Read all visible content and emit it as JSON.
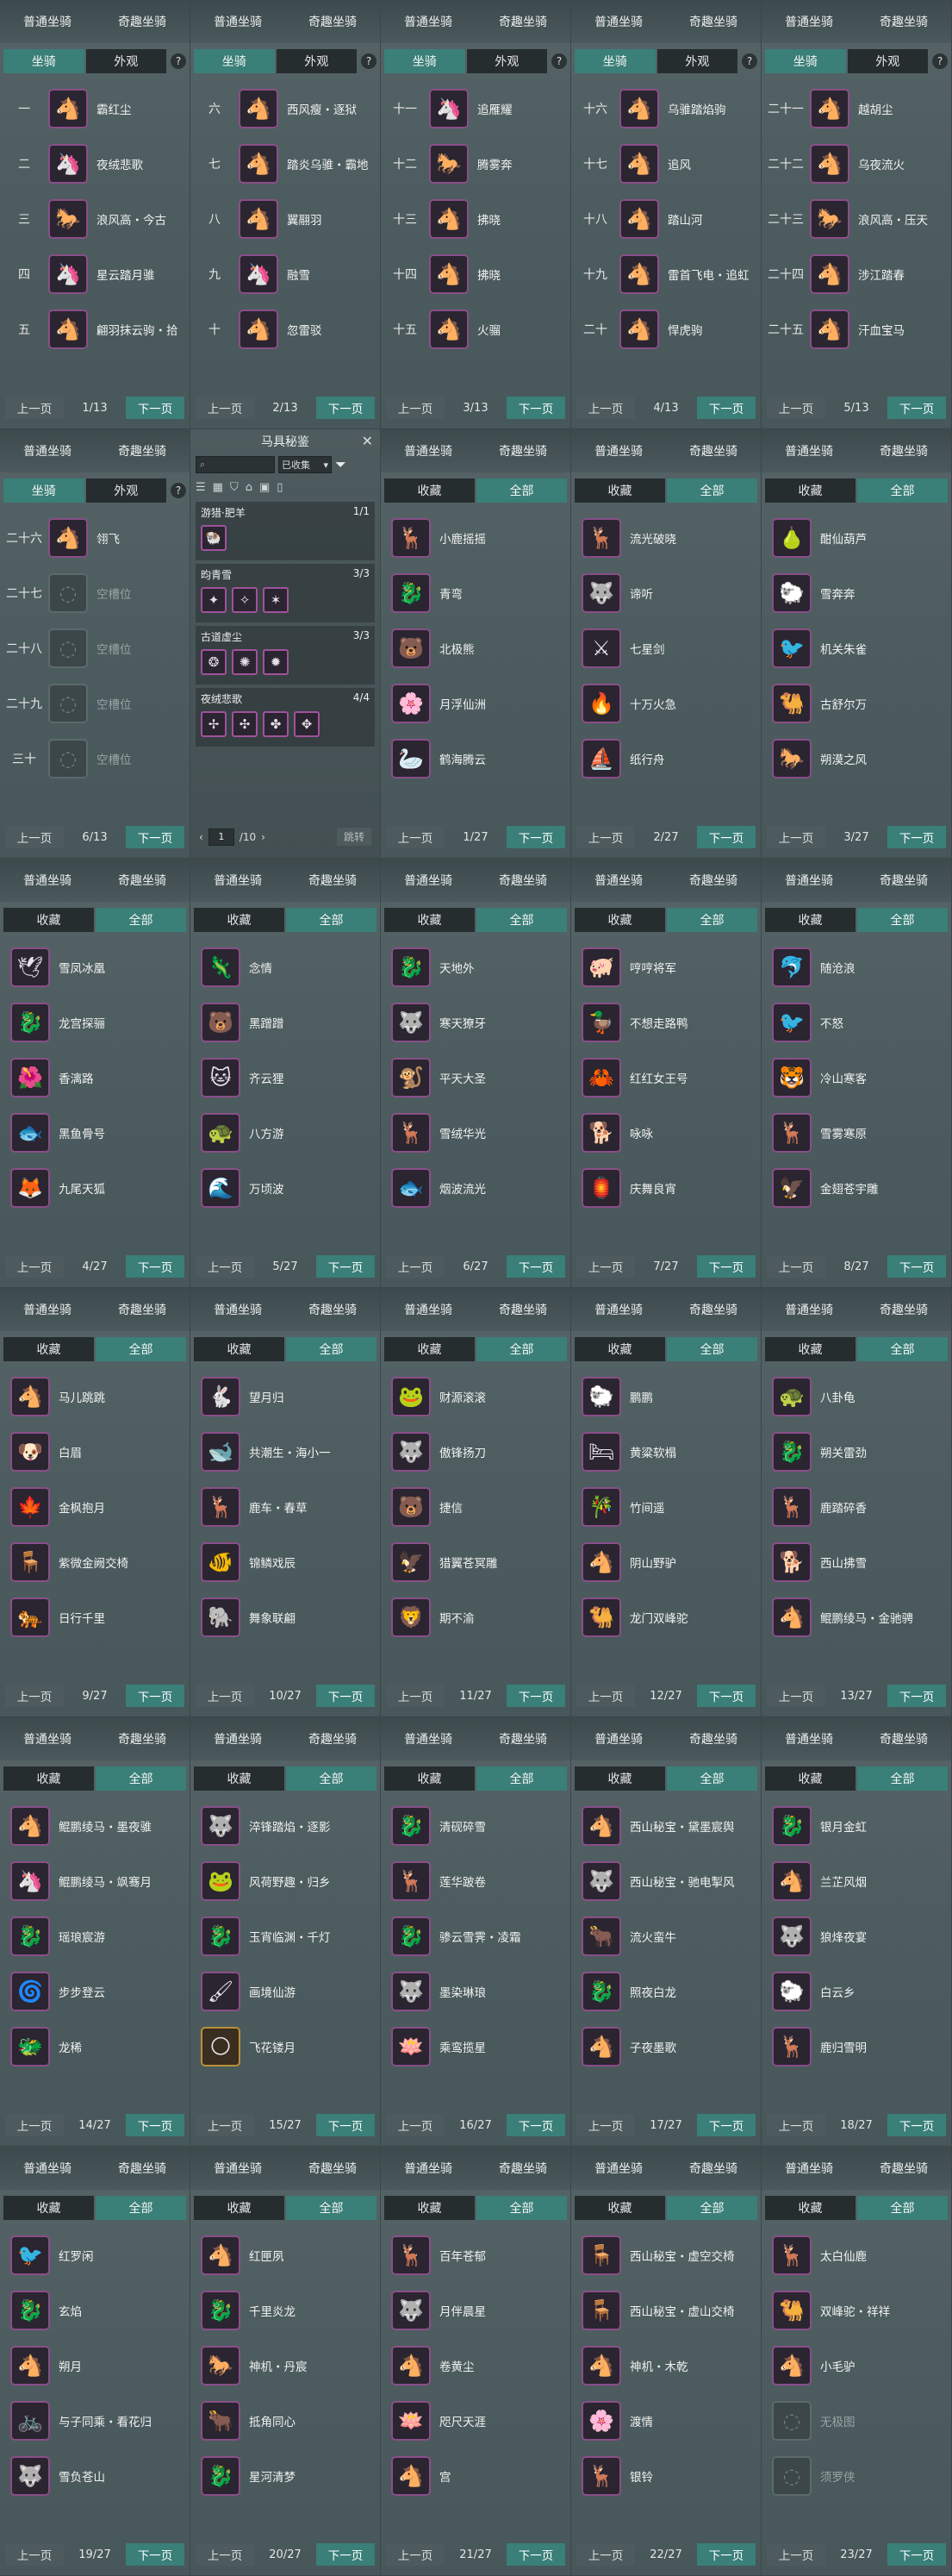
{
  "top_tabs": {
    "common": "普通坐骑",
    "fun": "奇趣坐骑"
  },
  "sub_tabs_mount": {
    "mount": "坐骑",
    "appearance": "外观",
    "help": "?"
  },
  "sub_tabs_item": {
    "favorite": "收藏",
    "all": "全部"
  },
  "pager": {
    "prev": "上一页",
    "next": "下一页"
  },
  "popup": {
    "title": "马具秘鉴",
    "close": "✕",
    "search_placeholder": "",
    "filter": "已收集",
    "sets": [
      {
        "name": "游猎·肥羊",
        "count": "1/1",
        "icons": [
          "🐏"
        ]
      },
      {
        "name": "昀青雪",
        "count": "3/3",
        "icons": [
          "✦",
          "✧",
          "✶"
        ]
      },
      {
        "name": "古道虚尘",
        "count": "3/3",
        "icons": [
          "❂",
          "✺",
          "✹"
        ]
      },
      {
        "name": "夜绒悲歌",
        "count": "4/4",
        "icons": [
          "✢",
          "✣",
          "✤",
          "✥"
        ]
      }
    ],
    "page_input": "1",
    "page_total": "/10",
    "jump": "跳转"
  },
  "panels": [
    {
      "kind": "mount",
      "page": "1/13",
      "rows": [
        {
          "num": "一",
          "name": "霸红尘",
          "icon": "🐴",
          "style": ""
        },
        {
          "num": "二",
          "name": "夜绒悲歌",
          "icon": "🦄",
          "style": ""
        },
        {
          "num": "三",
          "name": "浪风高・今古",
          "icon": "🐎",
          "style": ""
        },
        {
          "num": "四",
          "name": "星云踏月骓",
          "icon": "🦄",
          "style": ""
        },
        {
          "num": "五",
          "name": "翩羽抹云驹・拾",
          "icon": "🐴",
          "style": ""
        }
      ]
    },
    {
      "kind": "mount",
      "page": "2/13",
      "rows": [
        {
          "num": "六",
          "name": "西风瘦・逐狱",
          "icon": "🐴",
          "style": ""
        },
        {
          "num": "七",
          "name": "踏炎乌骓・霸地",
          "icon": "🐴",
          "style": ""
        },
        {
          "num": "八",
          "name": "翼翮羽",
          "icon": "🐴",
          "style": ""
        },
        {
          "num": "九",
          "name": "融雪",
          "icon": "🦄",
          "style": ""
        },
        {
          "num": "十",
          "name": "忽雷驳",
          "icon": "🐴",
          "style": ""
        }
      ]
    },
    {
      "kind": "mount",
      "page": "3/13",
      "rows": [
        {
          "num": "十一",
          "name": "追雁耀",
          "icon": "🦄",
          "style": ""
        },
        {
          "num": "十二",
          "name": "腾雾奔",
          "icon": "🐎",
          "style": ""
        },
        {
          "num": "十三",
          "name": "拂晓",
          "icon": "🐴",
          "style": ""
        },
        {
          "num": "十四",
          "name": "拂晓",
          "icon": "🐴",
          "style": ""
        },
        {
          "num": "十五",
          "name": "火骝",
          "icon": "🐴",
          "style": ""
        }
      ]
    },
    {
      "kind": "mount",
      "page": "4/13",
      "rows": [
        {
          "num": "十六",
          "name": "乌骓踏焰驹",
          "icon": "🐴",
          "style": ""
        },
        {
          "num": "十七",
          "name": "追风",
          "icon": "🐴",
          "style": ""
        },
        {
          "num": "十八",
          "name": "踏山河",
          "icon": "🐴",
          "style": ""
        },
        {
          "num": "十九",
          "name": "雷首飞电・追虹",
          "icon": "🐴",
          "style": ""
        },
        {
          "num": "二十",
          "name": "悍虎驹",
          "icon": "🐴",
          "style": ""
        }
      ]
    },
    {
      "kind": "mount",
      "page": "5/13",
      "rows": [
        {
          "num": "二十一",
          "name": "越胡尘",
          "icon": "🐴",
          "style": ""
        },
        {
          "num": "二十二",
          "name": "乌夜流火",
          "icon": "🐴",
          "style": ""
        },
        {
          "num": "二十三",
          "name": "浪风高・压天",
          "icon": "🐎",
          "style": ""
        },
        {
          "num": "二十四",
          "name": "涉江踏春",
          "icon": "🐴",
          "style": ""
        },
        {
          "num": "二十五",
          "name": "汗血宝马",
          "icon": "🐴",
          "style": ""
        }
      ]
    },
    {
      "kind": "mount",
      "page": "6/13",
      "rows": [
        {
          "num": "二十六",
          "name": "翎飞",
          "icon": "🐴",
          "style": ""
        },
        {
          "num": "二十七",
          "name": "空槽位",
          "icon": "◌",
          "style": "empty"
        },
        {
          "num": "二十八",
          "name": "空槽位",
          "icon": "◌",
          "style": "empty"
        },
        {
          "num": "二十九",
          "name": "空槽位",
          "icon": "◌",
          "style": "empty"
        },
        {
          "num": "三十",
          "name": "空槽位",
          "icon": "◌",
          "style": "empty"
        }
      ]
    },
    {
      "kind": "popup"
    },
    {
      "kind": "item",
      "page": "1/27",
      "rows": [
        {
          "name": "小鹿摇摇",
          "icon": "🦌",
          "style": ""
        },
        {
          "name": "青弯",
          "icon": "🐉",
          "style": ""
        },
        {
          "name": "北极熊",
          "icon": "🐻",
          "style": ""
        },
        {
          "name": "月浮仙洲",
          "icon": "🌸",
          "style": ""
        },
        {
          "name": "鹤海腾云",
          "icon": "🦢",
          "style": ""
        }
      ]
    },
    {
      "kind": "item",
      "page": "2/27",
      "rows": [
        {
          "name": "流光破晓",
          "icon": "🦌",
          "style": ""
        },
        {
          "name": "谛听",
          "icon": "🐺",
          "style": ""
        },
        {
          "name": "七星剑",
          "icon": "⚔",
          "style": ""
        },
        {
          "name": "十万火急",
          "icon": "🔥",
          "style": ""
        },
        {
          "name": "纸行舟",
          "icon": "⛵",
          "style": ""
        }
      ]
    },
    {
      "kind": "item",
      "page": "3/27",
      "rows": [
        {
          "name": "酣仙葫芦",
          "icon": "🍐",
          "style": ""
        },
        {
          "name": "雪奔奔",
          "icon": "🐑",
          "style": ""
        },
        {
          "name": "机关朱雀",
          "icon": "🐦",
          "style": ""
        },
        {
          "name": "古舒尔万",
          "icon": "🐫",
          "style": ""
        },
        {
          "name": "朔漠之风",
          "icon": "🐎",
          "style": ""
        }
      ]
    },
    {
      "kind": "item",
      "page": "4/27",
      "rows": [
        {
          "name": "雪凤冰凰",
          "icon": "🕊",
          "style": ""
        },
        {
          "name": "龙宫探骊",
          "icon": "🐉",
          "style": ""
        },
        {
          "name": "香漓路",
          "icon": "🌺",
          "style": ""
        },
        {
          "name": "黑鱼骨号",
          "icon": "🐟",
          "style": ""
        },
        {
          "name": "九尾天狐",
          "icon": "🦊",
          "style": ""
        }
      ]
    },
    {
      "kind": "item",
      "page": "5/27",
      "rows": [
        {
          "name": "念情",
          "icon": "🦎",
          "style": ""
        },
        {
          "name": "黑蹭蹭",
          "icon": "🐻",
          "style": ""
        },
        {
          "name": "齐云狸",
          "icon": "🐱",
          "style": ""
        },
        {
          "name": "八方游",
          "icon": "🐢",
          "style": ""
        },
        {
          "name": "万顷波",
          "icon": "🌊",
          "style": ""
        }
      ]
    },
    {
      "kind": "item",
      "page": "6/27",
      "rows": [
        {
          "name": "天地外",
          "icon": "🐉",
          "style": ""
        },
        {
          "name": "寒天獠牙",
          "icon": "🐺",
          "style": ""
        },
        {
          "name": "平天大圣",
          "icon": "🐒",
          "style": ""
        },
        {
          "name": "雪绒华光",
          "icon": "🦌",
          "style": ""
        },
        {
          "name": "烟波流光",
          "icon": "🐟",
          "style": ""
        }
      ]
    },
    {
      "kind": "item",
      "page": "7/27",
      "rows": [
        {
          "name": "哼哼将军",
          "icon": "🐖",
          "style": ""
        },
        {
          "name": "不想走路鸭",
          "icon": "🦆",
          "style": ""
        },
        {
          "name": "红红女王号",
          "icon": "🦀",
          "style": ""
        },
        {
          "name": "咏咏",
          "icon": "🐕",
          "style": ""
        },
        {
          "name": "庆舞良宵",
          "icon": "🏮",
          "style": ""
        }
      ]
    },
    {
      "kind": "item",
      "page": "8/27",
      "rows": [
        {
          "name": "随沧浪",
          "icon": "🐬",
          "style": ""
        },
        {
          "name": "不怒",
          "icon": "🐦",
          "style": ""
        },
        {
          "name": "冷山寒客",
          "icon": "🐯",
          "style": ""
        },
        {
          "name": "雪雾寒原",
          "icon": "🦌",
          "style": ""
        },
        {
          "name": "金翅苍宇雕",
          "icon": "🦅",
          "style": ""
        }
      ]
    },
    {
      "kind": "item",
      "page": "9/27",
      "rows": [
        {
          "name": "马儿跳跳",
          "icon": "🐴",
          "style": ""
        },
        {
          "name": "白眉",
          "icon": "🐶",
          "style": ""
        },
        {
          "name": "金枫抱月",
          "icon": "🍁",
          "style": ""
        },
        {
          "name": "紫微金阙交椅",
          "icon": "🪑",
          "style": ""
        },
        {
          "name": "日行千里",
          "icon": "🐅",
          "style": ""
        }
      ]
    },
    {
      "kind": "item",
      "page": "10/27",
      "rows": [
        {
          "name": "望月归",
          "icon": "🐇",
          "style": ""
        },
        {
          "name": "共潮生・海小一",
          "icon": "🐋",
          "style": ""
        },
        {
          "name": "鹿车・春草",
          "icon": "🦌",
          "style": ""
        },
        {
          "name": "锦鳞戏辰",
          "icon": "🐠",
          "style": ""
        },
        {
          "name": "舞象联翩",
          "icon": "🐘",
          "style": ""
        }
      ]
    },
    {
      "kind": "item",
      "page": "11/27",
      "rows": [
        {
          "name": "财源滚滚",
          "icon": "🐸",
          "style": ""
        },
        {
          "name": "傲锋扬刀",
          "icon": "🐺",
          "style": ""
        },
        {
          "name": "捷信",
          "icon": "🐻",
          "style": ""
        },
        {
          "name": "猎翼苍冥雕",
          "icon": "🦅",
          "style": ""
        },
        {
          "name": "期不渝",
          "icon": "🦁",
          "style": ""
        }
      ]
    },
    {
      "kind": "item",
      "page": "12/27",
      "rows": [
        {
          "name": "鹏鹏",
          "icon": "🐑",
          "style": ""
        },
        {
          "name": "黄粱软榻",
          "icon": "🛏",
          "style": ""
        },
        {
          "name": "竹间遥",
          "icon": "🎋",
          "style": ""
        },
        {
          "name": "阴山野驴",
          "icon": "🐴",
          "style": ""
        },
        {
          "name": "龙门双峰驼",
          "icon": "🐫",
          "style": ""
        }
      ]
    },
    {
      "kind": "item",
      "page": "13/27",
      "rows": [
        {
          "name": "八卦龟",
          "icon": "🐢",
          "style": ""
        },
        {
          "name": "朔关雷劲",
          "icon": "🐉",
          "style": ""
        },
        {
          "name": "鹿踏碎香",
          "icon": "🦌",
          "style": ""
        },
        {
          "name": "西山拂雪",
          "icon": "🐕",
          "style": ""
        },
        {
          "name": "鲲鹏绫马・金驰骋",
          "icon": "🐴",
          "style": ""
        }
      ]
    },
    {
      "kind": "item",
      "page": "14/27",
      "rows": [
        {
          "name": "鲲鹏绫马・墨夜骓",
          "icon": "🐴",
          "style": ""
        },
        {
          "name": "鲲鹏绫马・飒骞月",
          "icon": "🦄",
          "style": ""
        },
        {
          "name": "瑶琅宸游",
          "icon": "🐉",
          "style": ""
        },
        {
          "name": "步步登云",
          "icon": "🌀",
          "style": ""
        },
        {
          "name": "龙稀",
          "icon": "🐲",
          "style": ""
        }
      ]
    },
    {
      "kind": "item",
      "page": "15/27",
      "rows": [
        {
          "name": "淬锋踏焰・逐影",
          "icon": "🐺",
          "style": ""
        },
        {
          "name": "风荷野趣・归乡",
          "icon": "🐸",
          "style": ""
        },
        {
          "name": "玉宵临渊・千灯",
          "icon": "🐉",
          "style": ""
        },
        {
          "name": "画境仙游",
          "icon": "🖌",
          "style": ""
        },
        {
          "name": "飞花镂月",
          "icon": "🌕",
          "style": "gold"
        }
      ]
    },
    {
      "kind": "item",
      "page": "16/27",
      "rows": [
        {
          "name": "清砚碎雪",
          "icon": "🐉",
          "style": ""
        },
        {
          "name": "莲华跛卷",
          "icon": "🦌",
          "style": ""
        },
        {
          "name": "骖云雪霁・凌霜",
          "icon": "🐉",
          "style": ""
        },
        {
          "name": "墨染琳琅",
          "icon": "🐺",
          "style": ""
        },
        {
          "name": "乘鸾揽星",
          "icon": "🪷",
          "style": ""
        }
      ]
    },
    {
      "kind": "item",
      "page": "17/27",
      "rows": [
        {
          "name": "西山秘宝・黛墨宸舆",
          "icon": "🐴",
          "style": ""
        },
        {
          "name": "西山秘宝・驰电掣风",
          "icon": "🐺",
          "style": ""
        },
        {
          "name": "流火蛮牛",
          "icon": "🐂",
          "style": ""
        },
        {
          "name": "照夜白龙",
          "icon": "🐉",
          "style": ""
        },
        {
          "name": "子夜墨歌",
          "icon": "🐴",
          "style": ""
        }
      ]
    },
    {
      "kind": "item",
      "page": "18/27",
      "rows": [
        {
          "name": "银月金虹",
          "icon": "🐉",
          "style": ""
        },
        {
          "name": "兰芷风烟",
          "icon": "🐴",
          "style": ""
        },
        {
          "name": "狼烽夜宴",
          "icon": "🐺",
          "style": ""
        },
        {
          "name": "白云乡",
          "icon": "🐑",
          "style": ""
        },
        {
          "name": "鹿归雪明",
          "icon": "🦌",
          "style": ""
        }
      ]
    },
    {
      "kind": "item",
      "page": "19/27",
      "rows": [
        {
          "name": "红罗闲",
          "icon": "🐦",
          "style": ""
        },
        {
          "name": "玄焰",
          "icon": "🐉",
          "style": ""
        },
        {
          "name": "朔月",
          "icon": "🐴",
          "style": ""
        },
        {
          "name": "与子同乘・看花归",
          "icon": "🚲",
          "style": ""
        },
        {
          "name": "雪负苍山",
          "icon": "🐺",
          "style": ""
        }
      ]
    },
    {
      "kind": "item",
      "page": "20/27",
      "rows": [
        {
          "name": "红匣夙",
          "icon": "🐴",
          "style": ""
        },
        {
          "name": "千里炎龙",
          "icon": "🐉",
          "style": ""
        },
        {
          "name": "神机・丹宸",
          "icon": "🐎",
          "style": ""
        },
        {
          "name": "抵角同心",
          "icon": "🐂",
          "style": ""
        },
        {
          "name": "星河清梦",
          "icon": "🐉",
          "style": ""
        }
      ]
    },
    {
      "kind": "item",
      "page": "21/27",
      "rows": [
        {
          "name": "百年苍郁",
          "icon": "🦌",
          "style": ""
        },
        {
          "name": "月伴晨星",
          "icon": "🐺",
          "style": ""
        },
        {
          "name": "卷黄尘",
          "icon": "🐴",
          "style": ""
        },
        {
          "name": "咫尺天涯",
          "icon": "🪷",
          "style": ""
        },
        {
          "name": "宫",
          "icon": "🐴",
          "style": ""
        }
      ]
    },
    {
      "kind": "item",
      "page": "22/27",
      "rows": [
        {
          "name": "西山秘宝・虚空交椅",
          "icon": "🪑",
          "style": ""
        },
        {
          "name": "西山秘宝・虚山交椅",
          "icon": "🪑",
          "style": ""
        },
        {
          "name": "神机・木乾",
          "icon": "🐴",
          "style": ""
        },
        {
          "name": "渡情",
          "icon": "🌸",
          "style": ""
        },
        {
          "name": "银铃",
          "icon": "🦌",
          "style": ""
        }
      ]
    },
    {
      "kind": "item",
      "page": "23/27",
      "rows": [
        {
          "name": "太白仙鹿",
          "icon": "🦌",
          "style": ""
        },
        {
          "name": "双峰驼・祥祥",
          "icon": "🐫",
          "style": ""
        },
        {
          "name": "小毛驴",
          "icon": "🐴",
          "style": ""
        },
        {
          "name": "无极图",
          "icon": "◌",
          "style": "empty"
        },
        {
          "name": "须罗侠",
          "icon": "◌",
          "style": "empty"
        }
      ]
    }
  ]
}
